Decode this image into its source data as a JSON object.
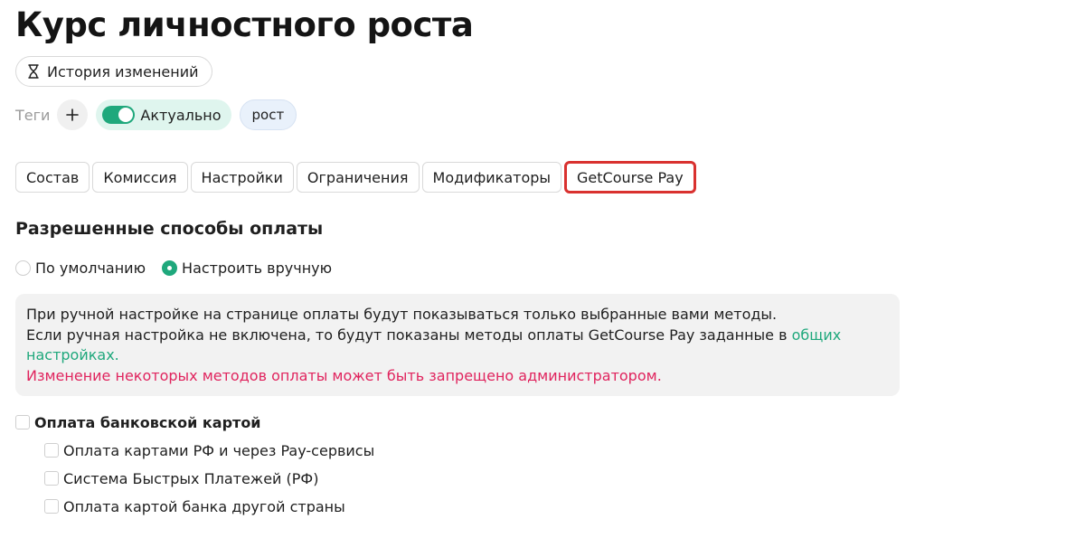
{
  "page": {
    "title": "Курс личностного роста"
  },
  "history": {
    "label": "История изменений",
    "icon": "hourglass-icon"
  },
  "tags": {
    "label": "Теги",
    "add_icon": "plus-icon",
    "status": {
      "label": "Актуально",
      "enabled": true
    },
    "items": [
      "рост"
    ]
  },
  "tabs": [
    {
      "label": "Состав",
      "active": false
    },
    {
      "label": "Комиссия",
      "active": false
    },
    {
      "label": "Настройки",
      "active": false
    },
    {
      "label": "Ограничения",
      "active": false
    },
    {
      "label": "Модификаторы",
      "active": false
    },
    {
      "label": "GetCourse Pay",
      "active": true
    }
  ],
  "payment": {
    "section_title": "Разрешенные способы оплаты",
    "mode_options": [
      {
        "label": "По умолчанию",
        "checked": false
      },
      {
        "label": "Настроить вручную",
        "checked": true
      }
    ],
    "info": {
      "line1": "При ручной настройке на странице оплаты будут показываться только выбранные вами методы.",
      "line2_prefix": "Если ручная настройка не включена, то будут показаны методы оплаты GetCourse Pay заданные в ",
      "line2_link": "общих настройках.",
      "warning": "Изменение некоторых методов оплаты может быть запрещено администратором."
    },
    "methods": {
      "group_label": "Оплата банковской картой",
      "group_checked": false,
      "items": [
        {
          "label": "Оплата картами РФ и через Pay-сервисы",
          "checked": false
        },
        {
          "label": "Система Быстрых Платежей (РФ)",
          "checked": false
        },
        {
          "label": "Оплата картой банка другой страны",
          "checked": false
        }
      ]
    }
  },
  "colors": {
    "accent_green": "#1fa87c",
    "warning_red": "#e0245e",
    "highlight_border": "#d9312f"
  }
}
